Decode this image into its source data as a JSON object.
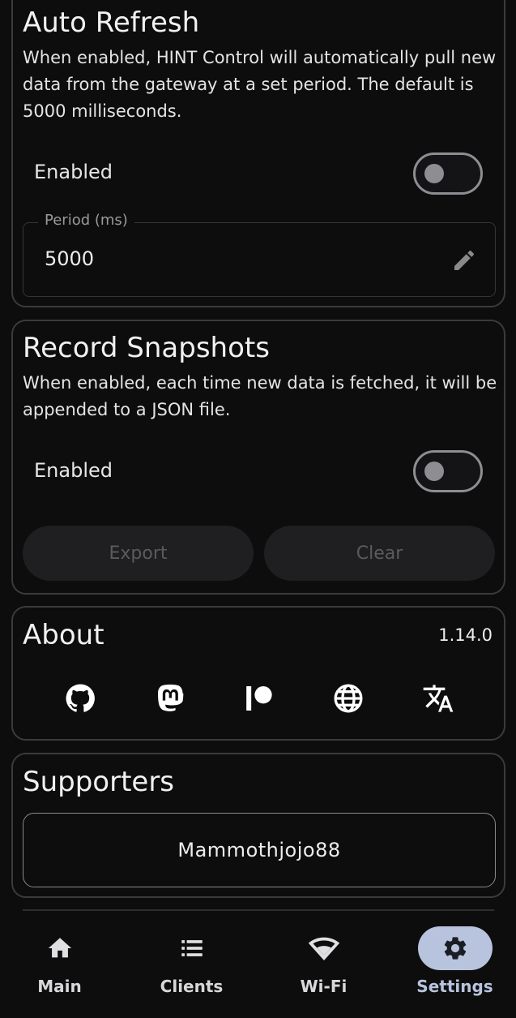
{
  "auto_refresh": {
    "title": "Auto Refresh",
    "description": "When enabled, HINT Control will automatically pull new data from the gateway at a set period. The default is 5000 milliseconds.",
    "enabled_label": "Enabled",
    "enabled": false,
    "period_label": "Period (ms)",
    "period_value": "5000"
  },
  "record_snapshots": {
    "title": "Record Snapshots",
    "description": "When enabled, each time new data is fetched, it will be appended to a JSON file.",
    "enabled_label": "Enabled",
    "enabled": false,
    "export_label": "Export",
    "clear_label": "Clear"
  },
  "about": {
    "title": "About",
    "version": "1.14.0",
    "icons": [
      "github-icon",
      "mastodon-icon",
      "patreon-icon",
      "globe-icon",
      "translate-icon"
    ]
  },
  "supporters": {
    "title": "Supporters",
    "names": [
      "Mammothjojo88"
    ]
  },
  "nav": {
    "items": [
      {
        "label": "Main",
        "icon": "home-icon"
      },
      {
        "label": "Clients",
        "icon": "list-icon"
      },
      {
        "label": "Wi-Fi",
        "icon": "wifi-icon"
      },
      {
        "label": "Settings",
        "icon": "gear-icon"
      }
    ],
    "active": "Settings"
  },
  "colors": {
    "background": "#0d0d0e",
    "accent": "#b8c4de",
    "border": "#3b3b3d"
  }
}
